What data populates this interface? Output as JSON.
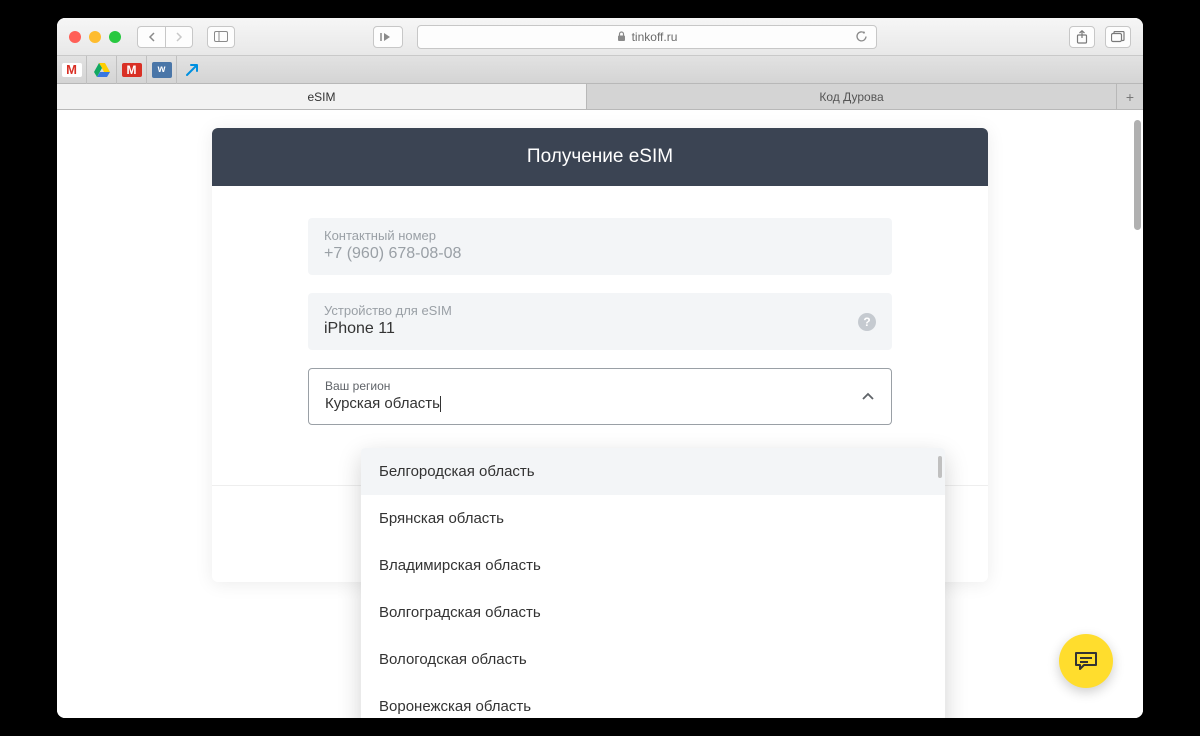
{
  "titlebar": {
    "url": "tinkoff.ru"
  },
  "tabs": {
    "active": "eSIM",
    "inactive": "Код Дурова"
  },
  "card": {
    "header": "Получение eSIM",
    "contact": {
      "label": "Контактный номер",
      "value": "+7 (960) 678-08-08"
    },
    "device": {
      "label": "Устройство для eSIM",
      "value": "iPhone 11"
    },
    "region": {
      "label": "Ваш регион",
      "value": "Курская область"
    }
  },
  "dropdown": {
    "items": [
      "Белгородская область",
      "Брянская область",
      "Владимирская область",
      "Волгоградская область",
      "Вологодская область",
      "Воронежская область"
    ]
  }
}
